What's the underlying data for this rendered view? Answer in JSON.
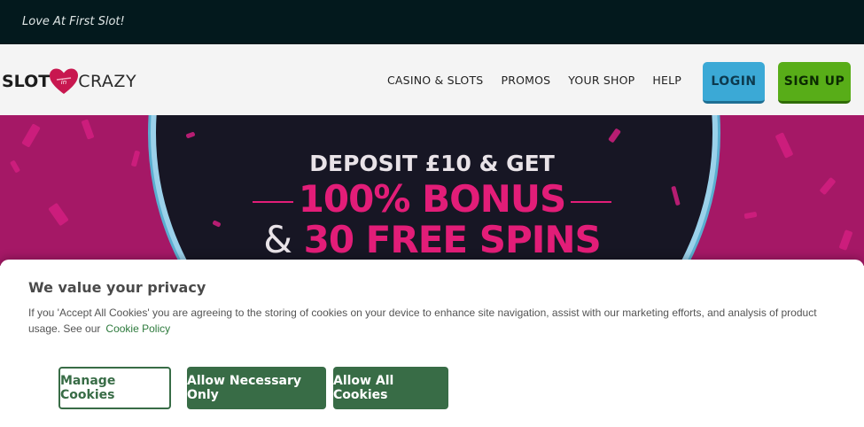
{
  "topbar": {
    "tagline": "Love At First Slot!"
  },
  "header": {
    "logo_left": "SLOT",
    "logo_right": "CRAZY",
    "nav": [
      "CASINO & SLOTS",
      "PROMOS",
      "YOUR SHOP",
      "HELP"
    ],
    "login_label": "LOGIN",
    "signup_label": "SIGN UP"
  },
  "banner": {
    "line1": "DEPOSIT £10 & GET",
    "line2": "100% BONUS",
    "line3_amp": "&",
    "line3": "30 FREE SPINS"
  },
  "cookie": {
    "title": "We value your privacy",
    "text": "If you 'Accept All Cookies' you are agreeing to the storing of cookies on your device to enhance site navigation, assist with our marketing efforts, and analysis of product usage. See our",
    "link": "Cookie Policy",
    "manage_label": "Manage Cookies",
    "necessary_label": "Allow Necessary Only",
    "all_label": "Allow All Cookies"
  },
  "colors": {
    "topbar": "#03191d",
    "banner": "#a51866",
    "accent_pink": "#e21d78",
    "login": "#3ba9d6",
    "signup": "#58ad18",
    "cookie_green": "#386c46"
  },
  "icons": {
    "logo_heart": "heart-logo-icon"
  }
}
